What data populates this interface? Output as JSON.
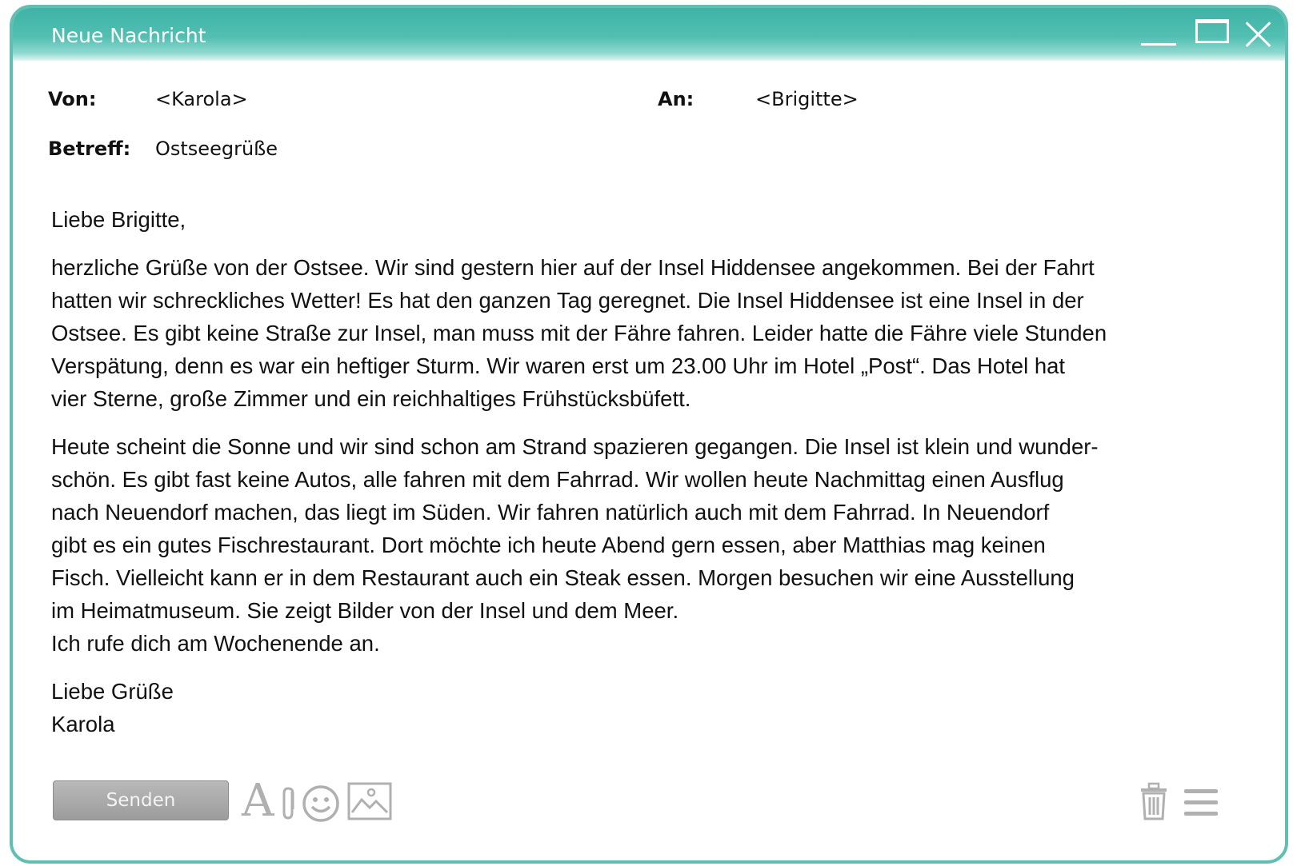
{
  "window": {
    "title": "Neue Nachricht"
  },
  "header": {
    "from_label": "Von:",
    "from_value": "<Karola>",
    "to_label": "An:",
    "to_value": "<Brigitte>",
    "subject_label": "Betreff:",
    "subject_value": "Ostseegrüße"
  },
  "message": {
    "greeting": "Liebe Brigitte,",
    "paragraph1": [
      "herzliche Grüße von der Ostsee. Wir sind gestern hier auf der Insel Hiddensee angekommen. Bei der Fahrt",
      "hatten wir schreckliches Wetter! Es hat den ganzen Tag geregnet. Die Insel Hiddensee ist eine Insel in der",
      "Ostsee. Es gibt keine Straße zur Insel, man muss mit der Fähre fahren. Leider hatte die Fähre viele Stunden",
      "Verspätung, denn es war ein heftiger Sturm. Wir waren erst um 23.00 Uhr im Hotel „Post“. Das Hotel hat",
      "vier Sterne, große Zimmer und ein reichhaltiges Frühstücksbüfett."
    ],
    "paragraph2": [
      "Heute scheint die Sonne und wir sind schon am Strand spazieren gegangen. Die Insel ist klein und wunder-",
      "schön. Es gibt fast keine Autos, alle fahren mit dem Fahrrad. Wir wollen heute Nachmittag einen Ausflug",
      "nach Neuendorf machen, das liegt im Süden. Wir fahren natürlich auch mit dem Fahrrad. In Neuendorf",
      "gibt es ein gutes Fischrestaurant. Dort möchte ich heute Abend gern essen, aber Matthias mag keinen",
      "Fisch. Vielleicht kann er in dem Restaurant auch ein Steak essen. Morgen besuchen wir eine Ausstellung",
      "im Heimatmuseum. Sie zeigt Bilder von der Insel und dem Meer.",
      "Ich rufe dich am Wochenende an."
    ],
    "closing": "Liebe Grüße",
    "signature": "Karola"
  },
  "toolbar": {
    "send_label": "Senden",
    "font_icon_glyph": "A",
    "icons": [
      "font-format-icon",
      "paperclip-icon",
      "smiley-icon",
      "image-icon",
      "trash-icon",
      "menu-icon"
    ]
  },
  "colors": {
    "title_bar": "#4bbaae",
    "border": "#5fbfb2",
    "send_button": "#aaaaaa",
    "icon_gray": "#b0b0b0"
  }
}
